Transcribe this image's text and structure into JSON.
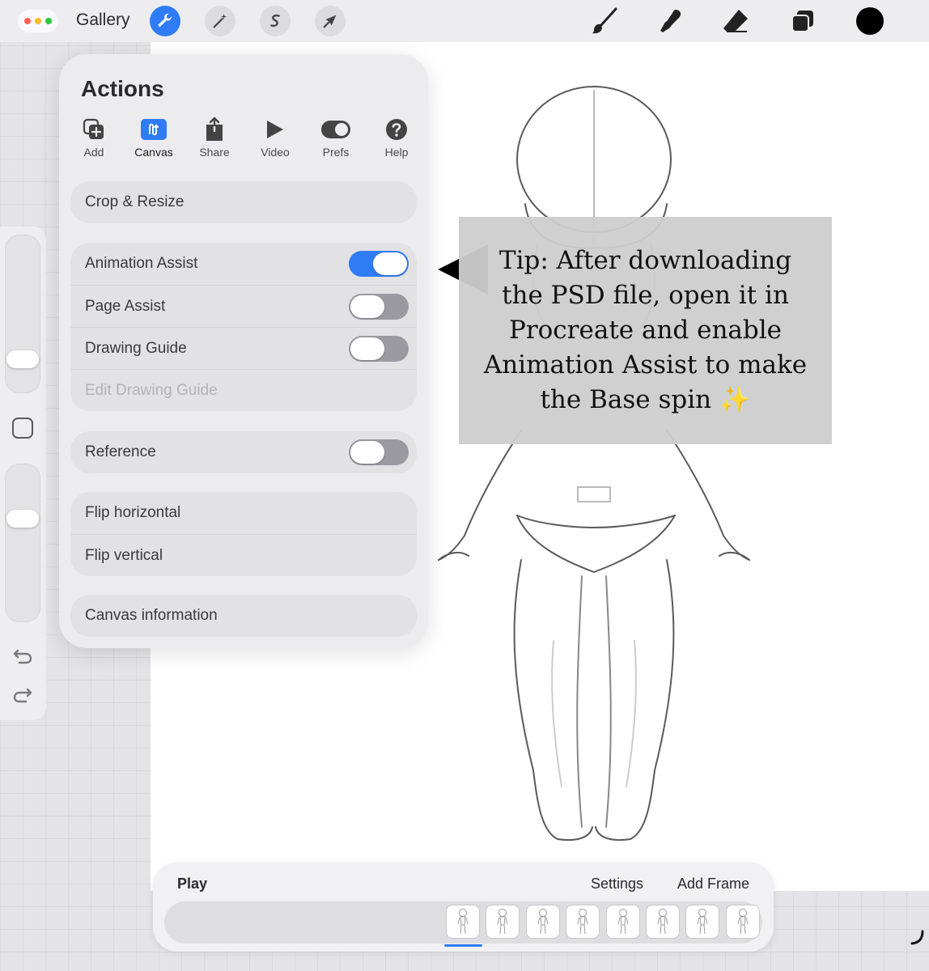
{
  "toolbar": {
    "gallery_label": "Gallery",
    "menu_dots_colors": [
      "#ff5f57",
      "#febc2e",
      "#28c840"
    ],
    "active_tool": "actions",
    "current_color": "#000000",
    "left_icons": [
      "wrench-icon",
      "magic-wand-icon",
      "selection-icon",
      "transform-arrow-icon"
    ],
    "right_icons": [
      "brush-icon",
      "smudge-icon",
      "eraser-icon",
      "layers-icon"
    ]
  },
  "actions": {
    "title": "Actions",
    "tabs": [
      {
        "label": "Add",
        "icon": "add-icon"
      },
      {
        "label": "Canvas",
        "icon": "canvas-icon",
        "active": true
      },
      {
        "label": "Share",
        "icon": "share-icon"
      },
      {
        "label": "Video",
        "icon": "video-icon"
      },
      {
        "label": "Prefs",
        "icon": "prefs-icon"
      },
      {
        "label": "Help",
        "icon": "help-icon"
      }
    ],
    "crop_resize": "Crop & Resize",
    "animation_assist": {
      "label": "Animation Assist",
      "on": true
    },
    "page_assist": {
      "label": "Page Assist",
      "on": false
    },
    "drawing_guide": {
      "label": "Drawing Guide",
      "on": false
    },
    "edit_drawing_guide": "Edit Drawing Guide",
    "reference": {
      "label": "Reference",
      "on": false
    },
    "flip_horizontal": "Flip horizontal",
    "flip_vertical": "Flip vertical",
    "canvas_information": "Canvas information"
  },
  "sidebar": {
    "brush_size_level": 0.7,
    "opacity_level": 0.7,
    "icons": [
      "modify-square-icon",
      "undo-icon",
      "redo-icon"
    ]
  },
  "tip": {
    "text": "Tip: After downloading the PSD file, open it in Procreate and enable Animation Assist to make the Base spin ✨"
  },
  "animation": {
    "play": "Play",
    "settings": "Settings",
    "add_frame": "Add Frame",
    "frame_count": 8,
    "selected_frame": 1,
    "accent": "#2f7cf6"
  }
}
